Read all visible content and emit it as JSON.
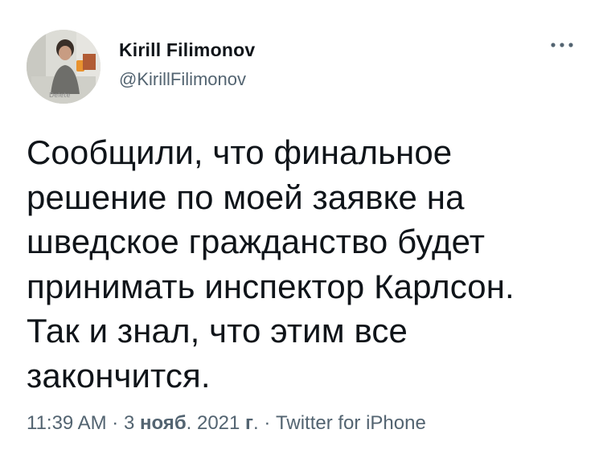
{
  "author": {
    "display_name": "Kirill Filimonov",
    "handle": "@KirillFilimonov",
    "avatar_icon": "profile-photo"
  },
  "menu": {
    "icon": "more-options-icon"
  },
  "tweet": {
    "text": "Сообщили, что финальное\nрешение по моей заявке на\nшведское гражданство будет\nпринимать инспектор Карлсон.\nТак и знал, что этим все\nзакончится."
  },
  "meta": {
    "time": "11:39 AM",
    "sep1": " · ",
    "day": "3 ",
    "month": "нояб",
    "year_prefix": ". 2021 ",
    "year_suffix": "г",
    "year_end": ".",
    "sep2": " · ",
    "source": "Twitter for iPhone"
  },
  "colors": {
    "text_primary": "#0f1419",
    "text_secondary": "#536471",
    "background": "#ffffff"
  }
}
